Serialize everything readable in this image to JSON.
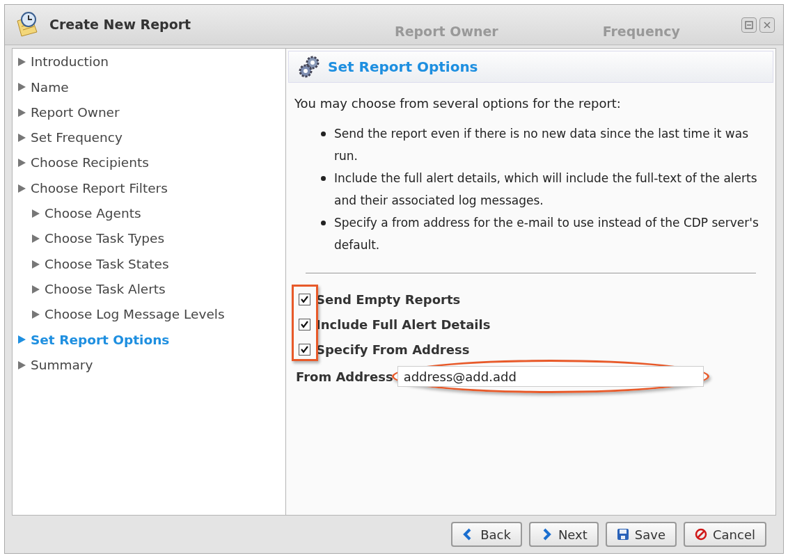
{
  "window": {
    "title": "Create New Report"
  },
  "background_tabs": [
    "Report Owner",
    "Frequency"
  ],
  "sidebar": {
    "items": [
      {
        "label": "Introduction",
        "selected": false
      },
      {
        "label": "Name",
        "selected": false
      },
      {
        "label": "Report Owner",
        "selected": false
      },
      {
        "label": "Set Frequency",
        "selected": false
      },
      {
        "label": "Choose Recipients",
        "selected": false
      },
      {
        "label": "Choose Report Filters",
        "selected": false,
        "children": [
          {
            "label": "Choose Agents",
            "selected": false
          },
          {
            "label": "Choose Task Types",
            "selected": false
          },
          {
            "label": "Choose Task States",
            "selected": false
          },
          {
            "label": "Choose Task Alerts",
            "selected": false
          },
          {
            "label": "Choose Log Message Levels",
            "selected": false
          }
        ]
      },
      {
        "label": "Set Report Options",
        "selected": true
      },
      {
        "label": "Summary",
        "selected": false
      }
    ]
  },
  "panel": {
    "title": "Set Report Options",
    "intro": "You may choose from several options for the report:",
    "bullets": [
      "Send the report even if there is no new data since the last time it was run.",
      "Include the full alert details, which will include the full-text of the alerts and their associated log messages.",
      "Specify a from address for the e-mail to use instead of the CDP server's default."
    ],
    "options": [
      {
        "label": "Send Empty Reports",
        "checked": true
      },
      {
        "label": "Include Full Alert Details",
        "checked": true
      },
      {
        "label": "Specify From Address",
        "checked": true
      }
    ],
    "from_address": {
      "label": "From Address",
      "value": "address@add.add"
    }
  },
  "buttons": [
    {
      "kind": "back",
      "label": "Back"
    },
    {
      "kind": "next",
      "label": "Next"
    },
    {
      "kind": "save",
      "label": "Save"
    },
    {
      "kind": "cancel",
      "label": "Cancel"
    }
  ]
}
